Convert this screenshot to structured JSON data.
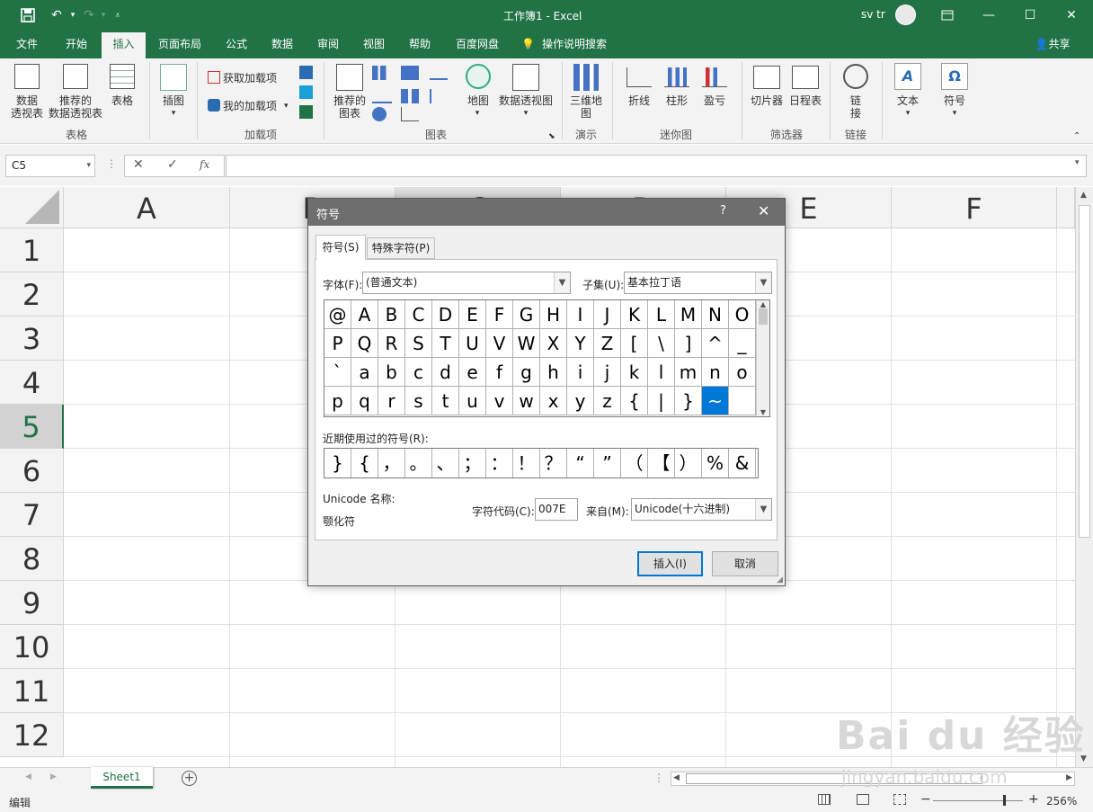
{
  "window": {
    "title": "工作簿1  -  Excel",
    "user": "sv tr"
  },
  "ribbon_tabs": [
    "文件",
    "开始",
    "插入",
    "页面布局",
    "公式",
    "数据",
    "审阅",
    "视图",
    "帮助",
    "百度网盘",
    "操作说明搜索"
  ],
  "share_label": "共享",
  "ribbon": {
    "pivot": "数据\n透视表",
    "rec_pivot": "推荐的\n数据透视表",
    "table": "表格",
    "group_tables": "表格",
    "illustrations": "插图",
    "get_addins": "获取加载项",
    "my_addins": "我的加载项",
    "group_addins": "加载项",
    "rec_charts": "推荐的\n图表",
    "maps": "地图",
    "pivot_chart": "数据透视图",
    "group_charts": "图表",
    "map3d": "三维地\n图",
    "group_tours": "演示",
    "spark_line": "折线",
    "spark_col": "柱形",
    "spark_wl": "盈亏",
    "group_spark": "迷你图",
    "slicer": "切片器",
    "timeline": "日程表",
    "group_filters": "筛选器",
    "link": "链\n接",
    "group_links": "链接",
    "text": "文本",
    "symbols": "符号"
  },
  "formula_bar": {
    "name_box": "C5",
    "fx": "fx",
    "value": ""
  },
  "columns": [
    "A",
    "B",
    "C",
    "D",
    "E",
    "F"
  ],
  "rows": [
    "1",
    "2",
    "3",
    "4",
    "5",
    "6",
    "7",
    "8",
    "9",
    "10",
    "11",
    "12"
  ],
  "sheet_tab": "Sheet1",
  "status": {
    "mode": "编辑",
    "zoom": "256%"
  },
  "dialog": {
    "title": "符号",
    "help": "?",
    "tabs": [
      "符号(S)",
      "特殊字符(P)"
    ],
    "font_label": "字体(F):",
    "font_value": "(普通文本)",
    "subset_label": "子集(U):",
    "subset_value": "基本拉丁语",
    "grid": [
      [
        "@",
        "A",
        "B",
        "C",
        "D",
        "E",
        "F",
        "G",
        "H",
        "I",
        "J",
        "K",
        "L",
        "M",
        "N",
        "O"
      ],
      [
        "P",
        "Q",
        "R",
        "S",
        "T",
        "U",
        "V",
        "W",
        "X",
        "Y",
        "Z",
        "[",
        "\\",
        "]",
        "^",
        "_"
      ],
      [
        "`",
        "a",
        "b",
        "c",
        "d",
        "e",
        "f",
        "g",
        "h",
        "i",
        "j",
        "k",
        "l",
        "m",
        "n",
        "o"
      ],
      [
        "p",
        "q",
        "r",
        "s",
        "t",
        "u",
        "v",
        "w",
        "x",
        "y",
        "z",
        "{",
        "|",
        "}",
        "~",
        ""
      ]
    ],
    "selected": "~",
    "recent_label": "近期使用过的符号(R):",
    "recent": [
      "}",
      "{",
      "，",
      "。",
      "、",
      "；",
      "：",
      "！",
      "？",
      "“",
      "”",
      "（",
      "【",
      "）",
      "%",
      "&"
    ],
    "unicode_name_label": "Unicode 名称:",
    "unicode_name": "颚化符",
    "code_label": "字符代码(C):",
    "code_value": "007E",
    "from_label": "来自(M):",
    "from_value": "Unicode(十六进制)",
    "insert": "插入(I)",
    "cancel": "取消"
  },
  "watermark": {
    "logo": "Bai du 经验",
    "url": "jingyan.baidu.com"
  }
}
